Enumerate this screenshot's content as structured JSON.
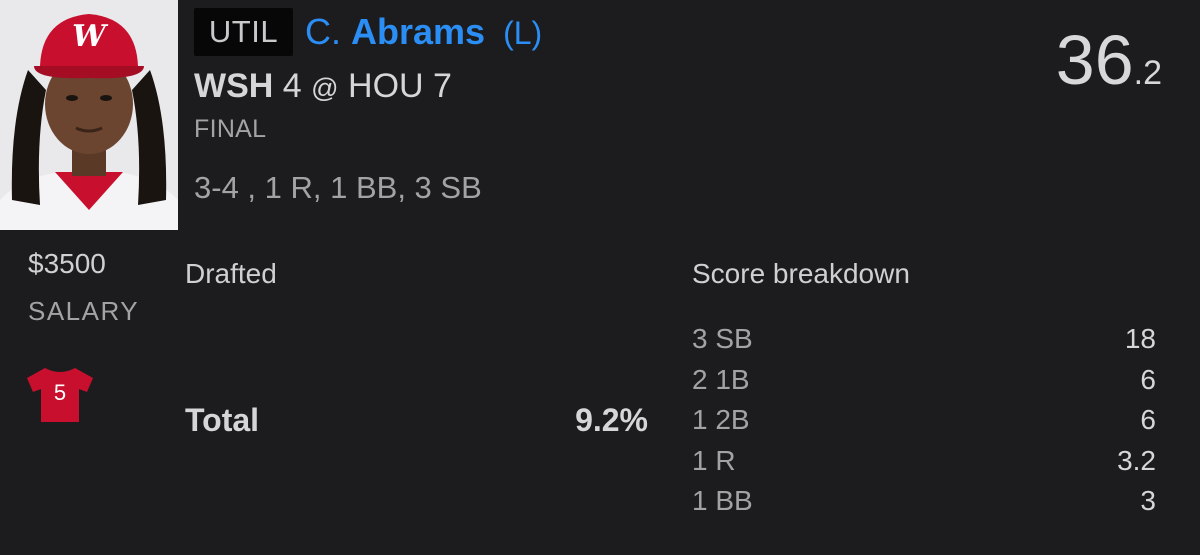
{
  "player": {
    "position": "UTIL",
    "first_initial": "C.",
    "last_name": "Abrams",
    "hand": "(L)",
    "salary": "$3500",
    "salary_label": "SALARY",
    "jersey_number": "5",
    "cap_logo": "W"
  },
  "game": {
    "away_team": "WSH",
    "away_score": "4",
    "at": "@",
    "home_team": "HOU",
    "home_score": "7",
    "status": "FINAL",
    "stat_line": "3-4 , 1 R, 1 BB, 3 SB"
  },
  "fantasy_points": {
    "integer": "36",
    "decimal": ".2"
  },
  "drafted": {
    "heading": "Drafted",
    "total_label": "Total",
    "total_value": "9.2%"
  },
  "breakdown": {
    "heading": "Score breakdown",
    "rows": [
      {
        "label": "3 SB",
        "value": "18"
      },
      {
        "label": "2 1B",
        "value": "6"
      },
      {
        "label": "1 2B",
        "value": "6"
      },
      {
        "label": "1 R",
        "value": "3.2"
      },
      {
        "label": "1 BB",
        "value": "3"
      }
    ]
  },
  "colors": {
    "background": "#1c1c1e",
    "accent_blue": "#2b8ef4",
    "jersey_red": "#c8102e",
    "text_primary": "#d6d6d8",
    "text_secondary": "#a3a3a6"
  },
  "icons": {
    "jersey": "jersey-icon",
    "photo": "player-headshot"
  }
}
